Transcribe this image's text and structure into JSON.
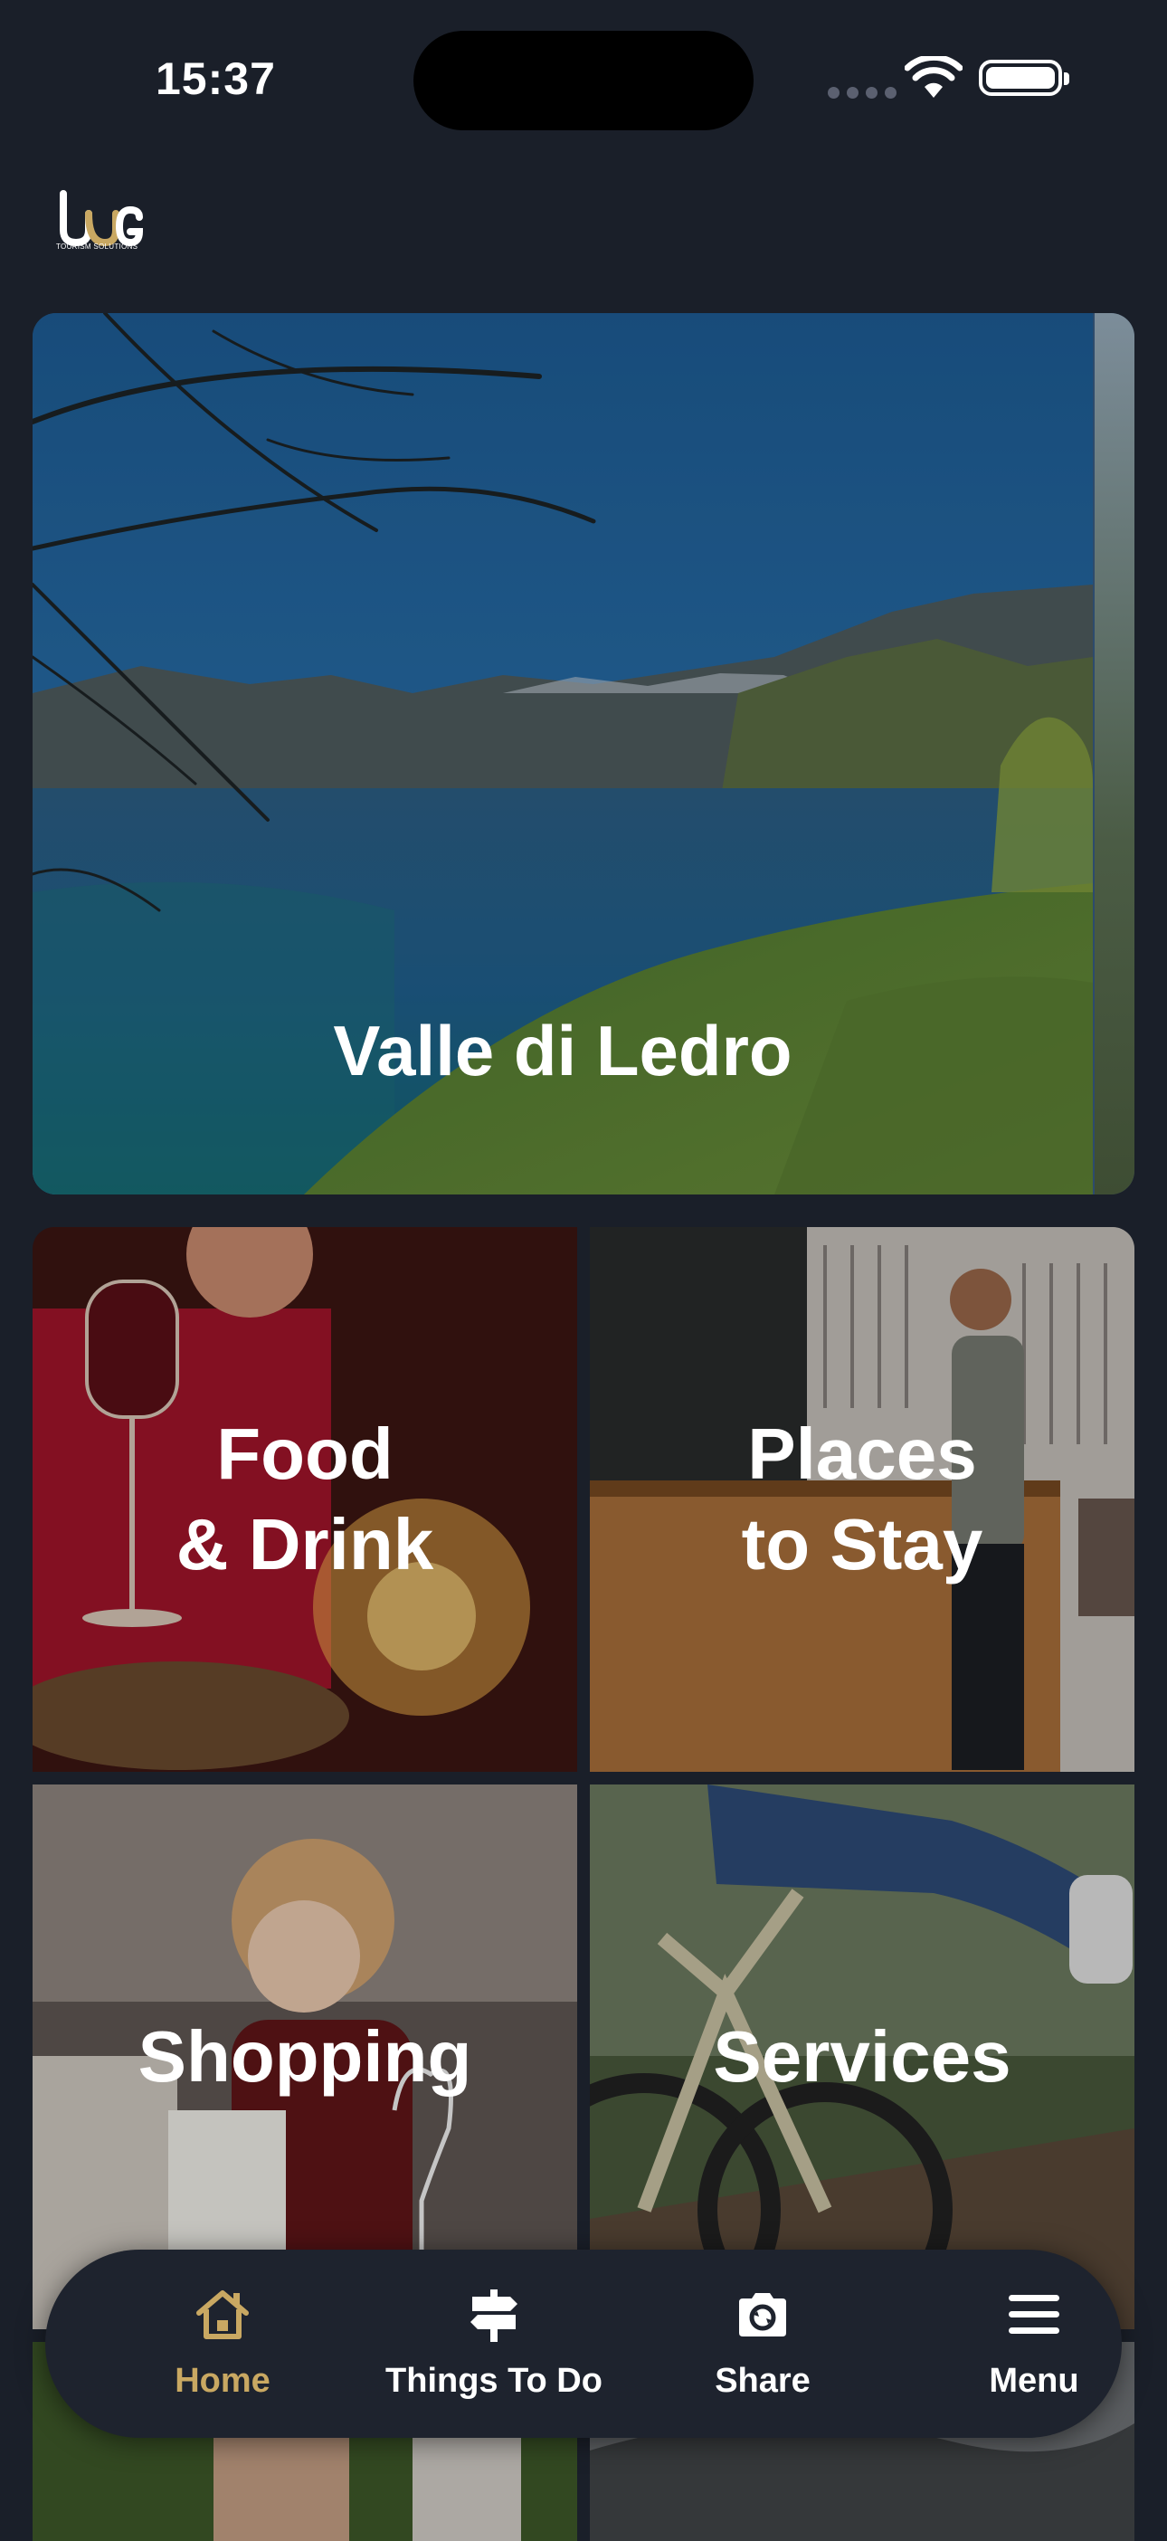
{
  "status_bar": {
    "time": "15:37"
  },
  "brand": {
    "logo_subtitle": "TOURISM SOLUTIONS"
  },
  "hero": {
    "title": "Valle di Ledro",
    "slides_count": 4,
    "active_slide": 3
  },
  "categories": [
    {
      "label": "Food\n& Drink"
    },
    {
      "label": "Places\nto Stay"
    },
    {
      "label": "Shopping"
    },
    {
      "label": "Services"
    }
  ],
  "nav": {
    "home": {
      "label": "Home",
      "icon": "home-icon",
      "active": true
    },
    "things_to_do": {
      "label": "Things To Do",
      "icon": "signpost-icon"
    },
    "share": {
      "label": "Share",
      "icon": "camera-icon"
    },
    "menu": {
      "label": "Menu",
      "icon": "hamburger-icon"
    }
  },
  "colors": {
    "background": "#1a1f29",
    "accent": "#c9a862",
    "nav_bg": "#1e232e"
  }
}
